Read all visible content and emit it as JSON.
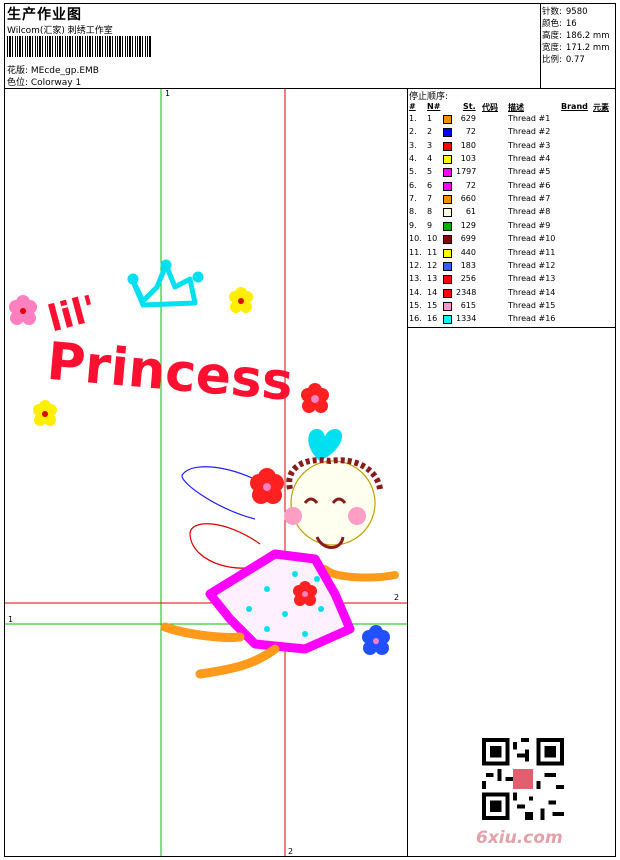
{
  "header": {
    "title": "生产作业图",
    "company": "Wilcom(汇家) 刺绣工作室",
    "design_label": "花版: MEcde_gp.EMB",
    "colorway_label": "色位: Colorway 1"
  },
  "stats": [
    {
      "label": "针数:",
      "value": "9580"
    },
    {
      "label": "颜色:",
      "value": "16"
    },
    {
      "label": "高度:",
      "value": "186.2 mm"
    },
    {
      "label": "宽度:",
      "value": "171.2 mm"
    },
    {
      "label": "比例:",
      "value": "0.77"
    }
  ],
  "stop_sequence_title": "停止顺序:",
  "table_headers": {
    "num": "#",
    "n": "N#",
    "stitches": "St.",
    "code": "代码",
    "desc": "描述",
    "brand": "Brand",
    "element": "元素"
  },
  "threads": [
    {
      "seq": "1.",
      "n": "1",
      "color": "#ff8c00",
      "stitches": "629",
      "desc": "Thread #1"
    },
    {
      "seq": "2.",
      "n": "2",
      "color": "#0000ff",
      "stitches": "72",
      "desc": "Thread #2"
    },
    {
      "seq": "3.",
      "n": "3",
      "color": "#ff0000",
      "stitches": "180",
      "desc": "Thread #3"
    },
    {
      "seq": "4.",
      "n": "4",
      "color": "#ffff00",
      "stitches": "103",
      "desc": "Thread #4"
    },
    {
      "seq": "5.",
      "n": "5",
      "color": "#ff00ff",
      "stitches": "1797",
      "desc": "Thread #5"
    },
    {
      "seq": "6.",
      "n": "6",
      "color": "#ff00ff",
      "stitches": "72",
      "desc": "Thread #6"
    },
    {
      "seq": "7.",
      "n": "7",
      "color": "#ff8c00",
      "stitches": "660",
      "desc": "Thread #7"
    },
    {
      "seq": "8.",
      "n": "8",
      "color": "#ffffe0",
      "stitches": "61",
      "desc": "Thread #8"
    },
    {
      "seq": "9.",
      "n": "9",
      "color": "#00b000",
      "stitches": "129",
      "desc": "Thread #9"
    },
    {
      "seq": "10.",
      "n": "10",
      "color": "#8b0000",
      "stitches": "699",
      "desc": "Thread #10"
    },
    {
      "seq": "11.",
      "n": "11",
      "color": "#ffff00",
      "stitches": "440",
      "desc": "Thread #11"
    },
    {
      "seq": "12.",
      "n": "12",
      "color": "#3060ff",
      "stitches": "183",
      "desc": "Thread #12"
    },
    {
      "seq": "13.",
      "n": "13",
      "color": "#ff0000",
      "stitches": "256",
      "desc": "Thread #13"
    },
    {
      "seq": "14.",
      "n": "14",
      "color": "#ff0000",
      "stitches": "2348",
      "desc": "Thread #14"
    },
    {
      "seq": "15.",
      "n": "15",
      "color": "#ff99cc",
      "stitches": "615",
      "desc": "Thread #15"
    },
    {
      "seq": "16.",
      "n": "16",
      "color": "#00ffff",
      "stitches": "1334",
      "desc": "Thread #16"
    }
  ],
  "design_text": {
    "lil": "lil'",
    "princess": "Princess"
  },
  "axis_marks": {
    "green_top": "1",
    "green_left": "1",
    "red_right": "2",
    "red_bottom": "2"
  },
  "watermark": "6xiu.com"
}
